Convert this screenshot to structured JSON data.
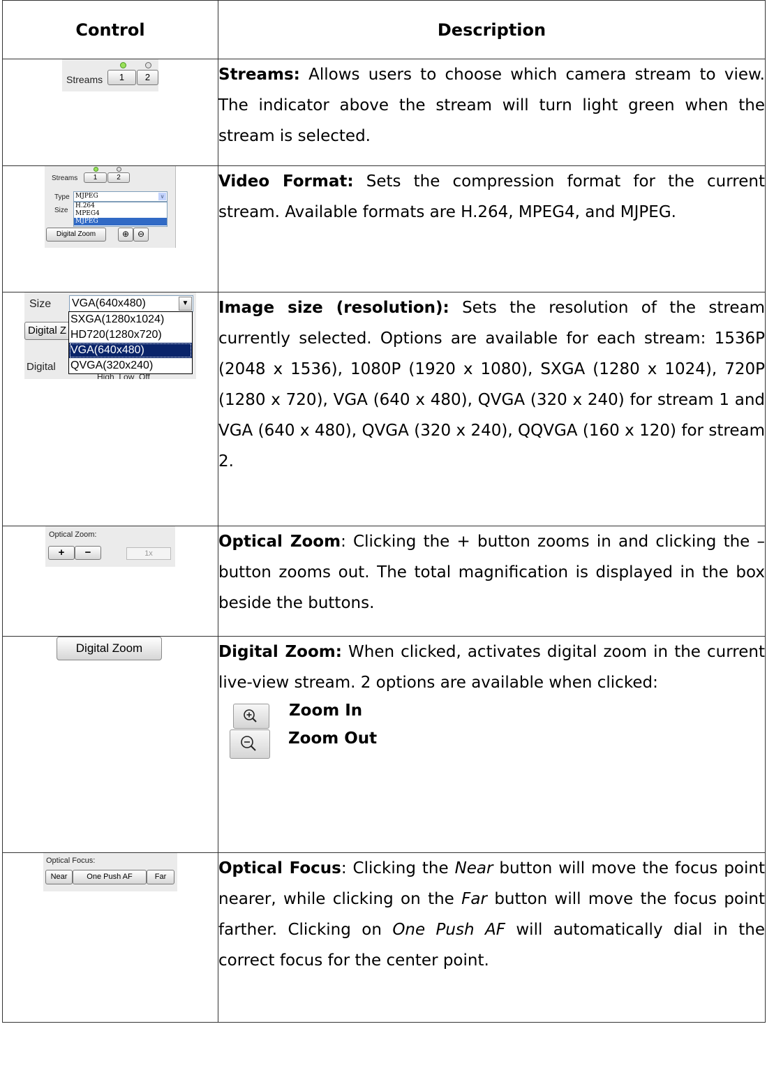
{
  "headers": {
    "control": "Control",
    "description": "Description"
  },
  "rows": {
    "streams": {
      "widget": {
        "label": "Streams",
        "btn1": "1",
        "btn2": "2"
      },
      "title": "Streams:",
      "text": " Allows users to choose which camera stream to view. The indicator above the stream will turn light green when the stream is selected."
    },
    "video_format": {
      "widget": {
        "streams_label": "Streams",
        "btn1": "1",
        "btn2": "2",
        "type_label": "Type",
        "type_value": "MJPEG",
        "size_label": "Size",
        "options": [
          "H.264",
          "MPEG4",
          "MJPEG"
        ],
        "digital_zoom": "Digital Zoom"
      },
      "title": "Video Format:",
      "text": " Sets the compression format for the current stream. Available formats are H.264, MPEG4, and MJPEG."
    },
    "image_size": {
      "widget": {
        "size_label": "Size",
        "value": "VGA(640x480)",
        "options": [
          "SXGA(1280x1024)",
          "HD720(1280x720)",
          "VGA(640x480)",
          "QVGA(320x240)"
        ],
        "digital_fragment": "Digital Z",
        "digital_fragment2": "Digital",
        "hidden_fragment": "High  Low  Off"
      },
      "title": "Image size (resolution):",
      "text": " Sets the resolution of the stream currently selected. Options are available for each stream: 1536P (2048 x 1536), 1080P (1920 x 1080), SXGA (1280 x 1024), 720P (1280 x 720), VGA (640 x 480), QVGA (320 x 240) for stream 1 and VGA (640 x 480), QVGA (320 x 240), QQVGA (160 x 120) for stream 2."
    },
    "optical_zoom": {
      "widget": {
        "label": "Optical Zoom:",
        "plus": "+",
        "minus": "−",
        "value": "1x"
      },
      "title": "Optical Zoom",
      "text": ": Clicking the + button zooms in and clicking the – button zooms out. The total magnification is displayed in the box beside the buttons."
    },
    "digital_zoom": {
      "widget": {
        "button": "Digital Zoom"
      },
      "title": "Digital Zoom:",
      "text": " When clicked, activates digital zoom in the current live-view stream. 2 options are available when clicked:",
      "zoom_in": "Zoom In",
      "zoom_out": "Zoom Out"
    },
    "optical_focus": {
      "widget": {
        "label": "Optical Focus:",
        "near": "Near",
        "one_push": "One Push AF",
        "far": "Far"
      },
      "title": "Optical Focus",
      "t1": ": Clicking the ",
      "near": "Near",
      "t2": " button will move the focus point nearer, while clicking on the ",
      "far": "Far",
      "t3": " button will move the focus point farther. Clicking on ",
      "one_push": "One Push AF",
      "t4": " will automatically dial in the correct focus for the center point."
    }
  }
}
